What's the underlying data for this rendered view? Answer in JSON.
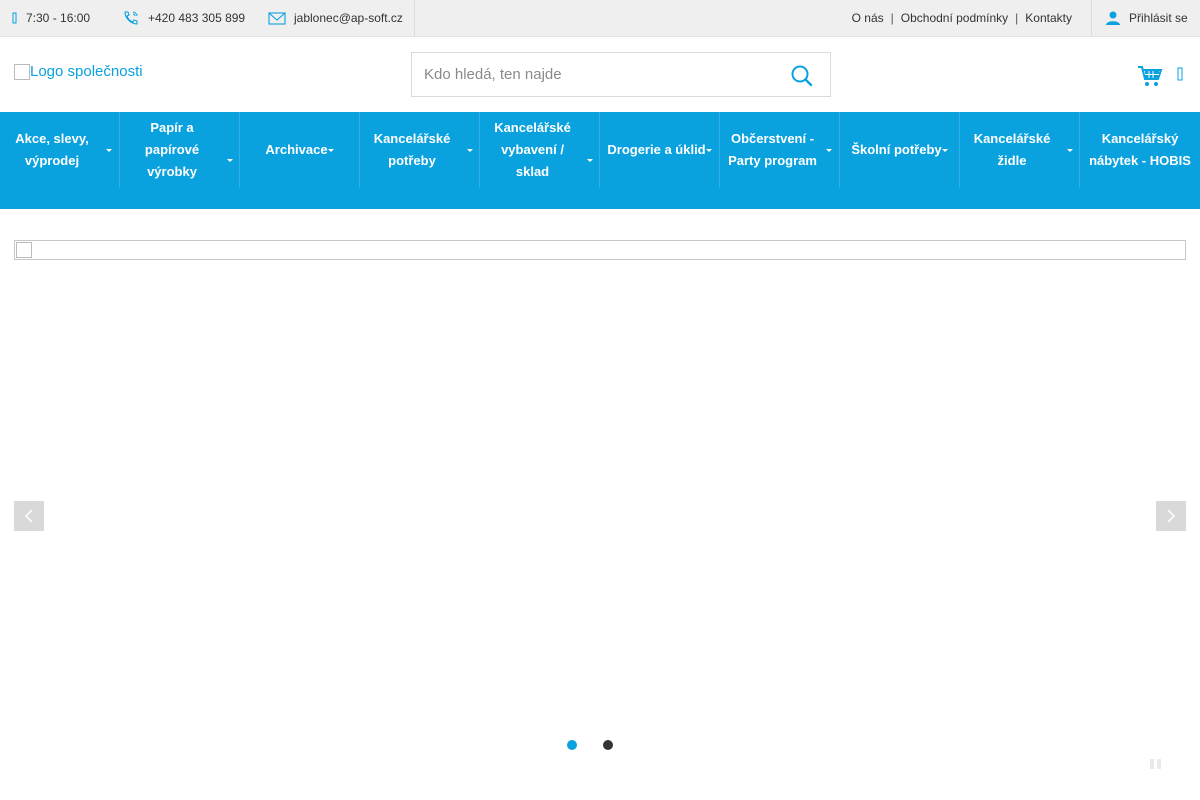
{
  "topbar": {
    "hours": "7:30 - 16:00",
    "phone": "+420 483 305 899",
    "email": "jablonec@ap-soft.cz",
    "links": [
      "O nás",
      "Obchodní podmínky",
      "Kontakty"
    ],
    "login_label": "Přihlásit se"
  },
  "header": {
    "logo_alt": "Logo společnosti",
    "search_placeholder": "Kdo hledá, ten najde",
    "icons": {
      "search": "search-icon",
      "cart": "cart-icon",
      "menu": "menu-icon"
    }
  },
  "nav": {
    "items": [
      {
        "label": "Akce, slevy, výprodej"
      },
      {
        "label": "Papír a papírové výrobky"
      },
      {
        "label": "Archivace"
      },
      {
        "label": "Kancelářské potřeby"
      },
      {
        "label": "Kancelářské vybavení / sklad"
      },
      {
        "label": "Drogerie a úklid"
      },
      {
        "label": "Občerstvení - Party program"
      },
      {
        "label": "Školní potřeby"
      },
      {
        "label": "Kancelářské židle"
      },
      {
        "label": "Kancelářský nábytek - HOBIS"
      }
    ]
  },
  "slider": {
    "slide_count": 2,
    "active_slide": 1
  },
  "colors": {
    "accent": "#0aa1df",
    "topbar_bg": "#efefef",
    "dot_inactive": "#333333"
  }
}
